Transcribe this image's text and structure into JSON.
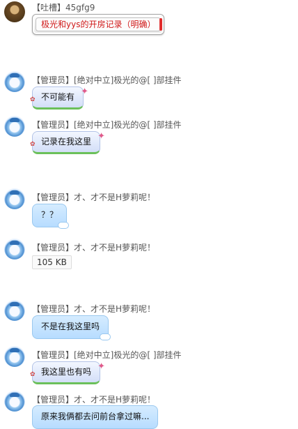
{
  "messages": [
    {
      "sender": "【吐槽】45gfg9",
      "text": "极光和yys的开房记录（明确）"
    },
    {
      "sender": "【管理员】[绝对中立]极光的@[  ]部挂件",
      "text": "不可能有"
    },
    {
      "sender": "【管理员】[绝对中立]极光的@[  ]部挂件",
      "text": "记录在我这里"
    },
    {
      "sender": "【管理员】才、才不是H萝莉呢！",
      "text": "？？"
    },
    {
      "sender": "【管理员】才、才不是H萝莉呢！",
      "file_size": "105 KB"
    },
    {
      "sender": "【管理员】才、才不是H萝莉呢！",
      "text": "不是在我这里吗"
    },
    {
      "sender": "【管理员】[绝对中立]极光的@[  ]部挂件",
      "text": "我这里也有吗"
    },
    {
      "sender": "【管理员】才、才不是H萝莉呢！",
      "text": "原来我俩都去问前台拿过嘛..."
    }
  ],
  "colors": {
    "red_text": "#d01a1a",
    "purple_bubble": "#dfe8fb",
    "blue_bubble": "#b7dcff",
    "green_accent": "#6bc05a"
  }
}
